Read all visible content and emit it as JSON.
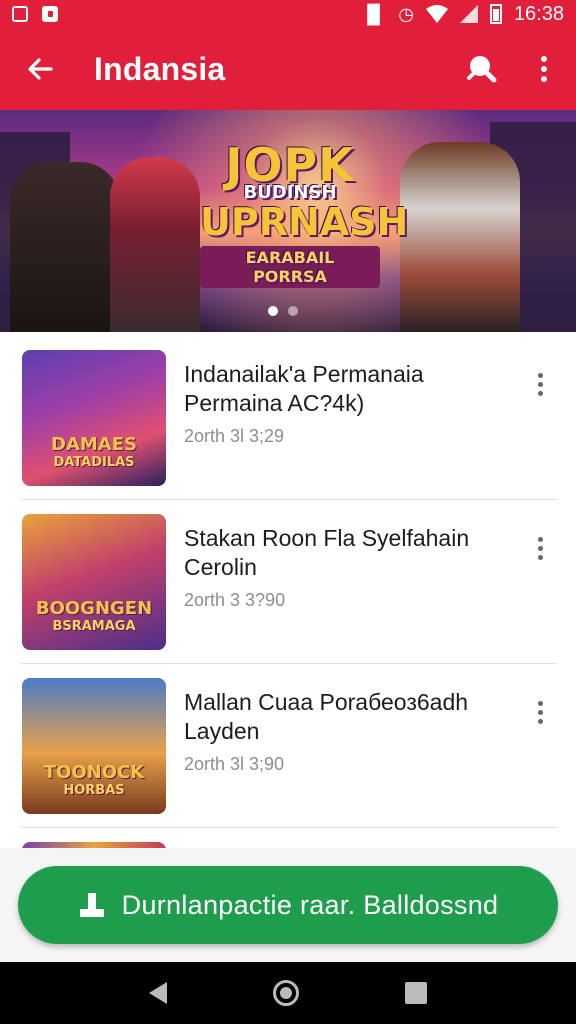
{
  "status_bar": {
    "time": "16:38",
    "icons": [
      "gallery-icon",
      "notification-icon",
      "vibrate-icon",
      "alarm-icon",
      "wifi-icon",
      "signal-icon",
      "battery-icon"
    ]
  },
  "app_bar": {
    "title": "Indansia",
    "back_icon": "arrow-left-icon",
    "search_icon": "search-icon",
    "more_icon": "more-vert-icon",
    "background_color": "#e21f3a"
  },
  "banner": {
    "logo_line1": "JOPK",
    "logo_line2": "BUDINSH",
    "logo_line3": "UPRNASH",
    "logo_line4": "EARABAIL PORRSA",
    "slides": 2,
    "active_slide": 0
  },
  "items": [
    {
      "title": "Indanailak'a Permanaia Permaina AC?4k)",
      "meta": "2orth 3l 3;29",
      "thumb_text": "DAMAES",
      "thumb_sub": "DATADILAS"
    },
    {
      "title": "Stakan Roon Fla Syelfahain Cerolin",
      "meta": "2orth 3 3?90",
      "thumb_text": "BOOGNGEN",
      "thumb_sub": "BSRAMAGA"
    },
    {
      "title": "Mallan Cuaa Poraбеоз6adh Layden",
      "meta": "2orth 3l 3;90",
      "thumb_text": "TOONOCK",
      "thumb_sub": "HORBAS"
    }
  ],
  "cta": {
    "label": "Durnlanpactie raar. Balldossnd",
    "icon": "download-icon",
    "color": "#1e9e4d"
  },
  "nav_bar": {
    "back_icon": "nav-back-icon",
    "home_icon": "nav-home-icon",
    "recent_icon": "nav-recents-icon"
  }
}
